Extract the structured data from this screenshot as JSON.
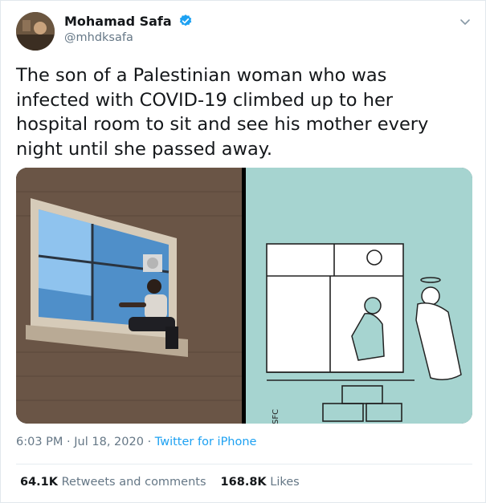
{
  "user": {
    "name": "Mohamad Safa",
    "handle": "@mhdksafa",
    "verified": true
  },
  "tweet": {
    "text": "The son of a Palestinian woman who was infected with COVID-19 climbed up to her hospital room to sit and see his mother every night until she passed away."
  },
  "meta": {
    "time": "6:03 PM",
    "separator": "·",
    "date": "Jul 18, 2020",
    "source": "Twitter for iPhone"
  },
  "stats": {
    "retweets_count": "64.1K",
    "retweets_label": "Retweets and comments",
    "likes_count": "168.8K",
    "likes_label": "Likes"
  },
  "colors": {
    "link": "#1da1f2",
    "secondary_text": "#657786",
    "cartoon_bg": "#a6d4d0"
  },
  "icons": [
    "verified-badge-icon",
    "chevron-down-icon"
  ]
}
